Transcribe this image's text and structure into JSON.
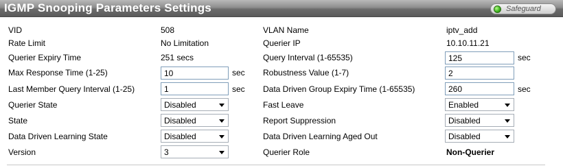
{
  "title": "IGMP Snooping Parameters Settings",
  "safeguard": {
    "label": "Safeguard",
    "status_color": "#3fb51f"
  },
  "left": {
    "vid": {
      "label": "VID",
      "value": "508"
    },
    "rate_limit": {
      "label": "Rate Limit",
      "value": "No Limitation"
    },
    "querier_expiry": {
      "label": "Querier Expiry Time",
      "value": "251 secs"
    },
    "max_response": {
      "label": "Max Response Time (1-25)",
      "value": "10",
      "unit": "sec"
    },
    "last_member": {
      "label": "Last Member Query Interval (1-25)",
      "value": "1",
      "unit": "sec"
    },
    "querier_state": {
      "label": "Querier State",
      "value": "Disabled"
    },
    "state": {
      "label": "State",
      "value": "Disabled"
    },
    "dd_learning": {
      "label": "Data Driven Learning State",
      "value": "Disabled"
    },
    "version": {
      "label": "Version",
      "value": "3"
    }
  },
  "right": {
    "vlan_name": {
      "label": "VLAN Name",
      "value": "iptv_add"
    },
    "querier_ip": {
      "label": "Querier IP",
      "value": "10.10.11.21"
    },
    "query_interval": {
      "label": "Query Interval (1-65535)",
      "value": "125",
      "unit": "sec"
    },
    "robustness": {
      "label": "Robustness Value (1-7)",
      "value": "2"
    },
    "dd_group_expiry": {
      "label": "Data Driven Group Expiry Time (1-65535)",
      "value": "260",
      "unit": "sec"
    },
    "fast_leave": {
      "label": "Fast Leave",
      "value": "Enabled"
    },
    "report_suppression": {
      "label": "Report Suppression",
      "value": "Disabled"
    },
    "dd_aged_out": {
      "label": "Data Driven Learning Aged Out",
      "value": "Disabled"
    },
    "querier_role": {
      "label": "Querier Role",
      "value": "Non-Querier"
    }
  }
}
